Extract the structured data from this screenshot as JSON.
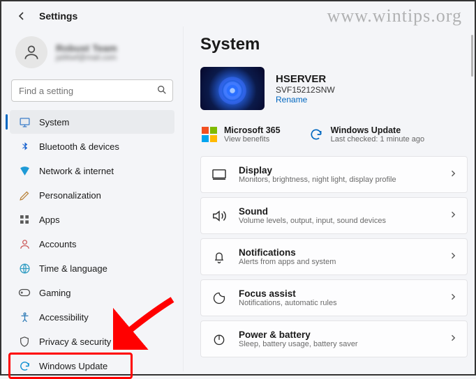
{
  "watermark": "www.wintips.org",
  "header": {
    "title": "Settings"
  },
  "account": {
    "name": "Robust Team",
    "email": "ja96wf@mail.com"
  },
  "search": {
    "placeholder": "Find a setting"
  },
  "sidebar": {
    "items": [
      {
        "label": "System",
        "icon": "system-icon",
        "active": true
      },
      {
        "label": "Bluetooth & devices",
        "icon": "bluetooth-icon"
      },
      {
        "label": "Network & internet",
        "icon": "network-icon"
      },
      {
        "label": "Personalization",
        "icon": "personalization-icon"
      },
      {
        "label": "Apps",
        "icon": "apps-icon"
      },
      {
        "label": "Accounts",
        "icon": "accounts-icon"
      },
      {
        "label": "Time & language",
        "icon": "time-language-icon"
      },
      {
        "label": "Gaming",
        "icon": "gaming-icon"
      },
      {
        "label": "Accessibility",
        "icon": "accessibility-icon"
      },
      {
        "label": "Privacy & security",
        "icon": "privacy-icon"
      },
      {
        "label": "Windows Update",
        "icon": "windows-update-icon",
        "highlighted": true
      }
    ]
  },
  "main": {
    "heading": "System",
    "device": {
      "name": "HSERVER",
      "model": "SVF15212SNW",
      "rename_label": "Rename"
    },
    "services": {
      "m365_title": "Microsoft 365",
      "m365_sub": "View benefits",
      "wu_title": "Windows Update",
      "wu_sub": "Last checked: 1 minute ago"
    },
    "cards": [
      {
        "title": "Display",
        "sub": "Monitors, brightness, night light, display profile",
        "icon": "display-icon"
      },
      {
        "title": "Sound",
        "sub": "Volume levels, output, input, sound devices",
        "icon": "sound-icon"
      },
      {
        "title": "Notifications",
        "sub": "Alerts from apps and system",
        "icon": "notifications-icon"
      },
      {
        "title": "Focus assist",
        "sub": "Notifications, automatic rules",
        "icon": "focus-assist-icon"
      },
      {
        "title": "Power & battery",
        "sub": "Sleep, battery usage, battery saver",
        "icon": "power-icon"
      }
    ]
  }
}
